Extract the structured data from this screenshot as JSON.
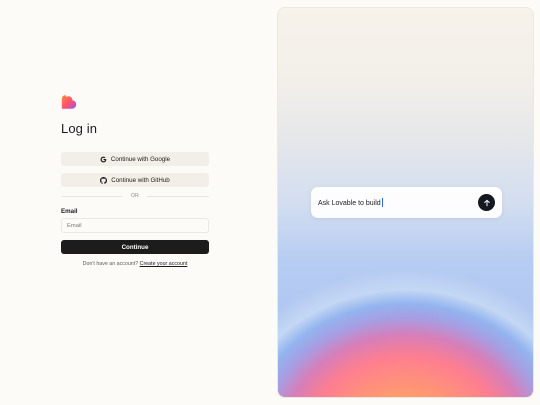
{
  "login": {
    "title": "Log in",
    "google_label": "Continue with Google",
    "github_label": "Continue with GitHub",
    "divider": "OR",
    "email_label": "Email",
    "email_placeholder": "Email",
    "email_value": "",
    "continue_label": "Continue",
    "no_account_text": "Don't have an account?",
    "create_account_link": "Create your account"
  },
  "hero": {
    "prompt_text": "Ask Lovable to build",
    "send_icon": "arrow-up-icon"
  },
  "icons": {
    "logo": "lovable-heart-logo",
    "google": "google-icon",
    "github": "github-icon"
  },
  "colors": {
    "page_bg": "#fcfbf8",
    "button_dark": "#1c1c1c",
    "oauth_bg": "#f2efe8",
    "logo_orange": "#ff6b3d",
    "logo_purple": "#8a5cf6"
  }
}
